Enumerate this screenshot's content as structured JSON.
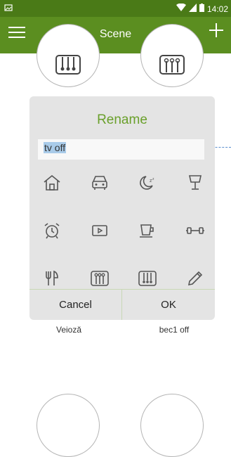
{
  "status_bar": {
    "time": "14:02"
  },
  "app_bar": {
    "title": "Scene"
  },
  "scenes_top": [
    {
      "icon": "sliders-down-icon"
    },
    {
      "icon": "sliders-up-icon"
    }
  ],
  "scenes_mid_labels": [
    "Veioză",
    "bec1 off"
  ],
  "dialog": {
    "title": "Rename",
    "input_value": "tv off",
    "icons": [
      "home-icon",
      "car-icon",
      "night-icon",
      "lamp-icon",
      "alarm-clock-icon",
      "play-icon",
      "coffee-cup-icon",
      "dumbbell-icon",
      "utensils-icon",
      "sliders-up-icon",
      "sliders-down-icon",
      "pencil-icon"
    ],
    "cancel_label": "Cancel",
    "ok_label": "OK"
  },
  "colors": {
    "app_bar": "#5b8e20",
    "status_bar": "#4a7a17",
    "dialog_title": "#6aa02b"
  }
}
